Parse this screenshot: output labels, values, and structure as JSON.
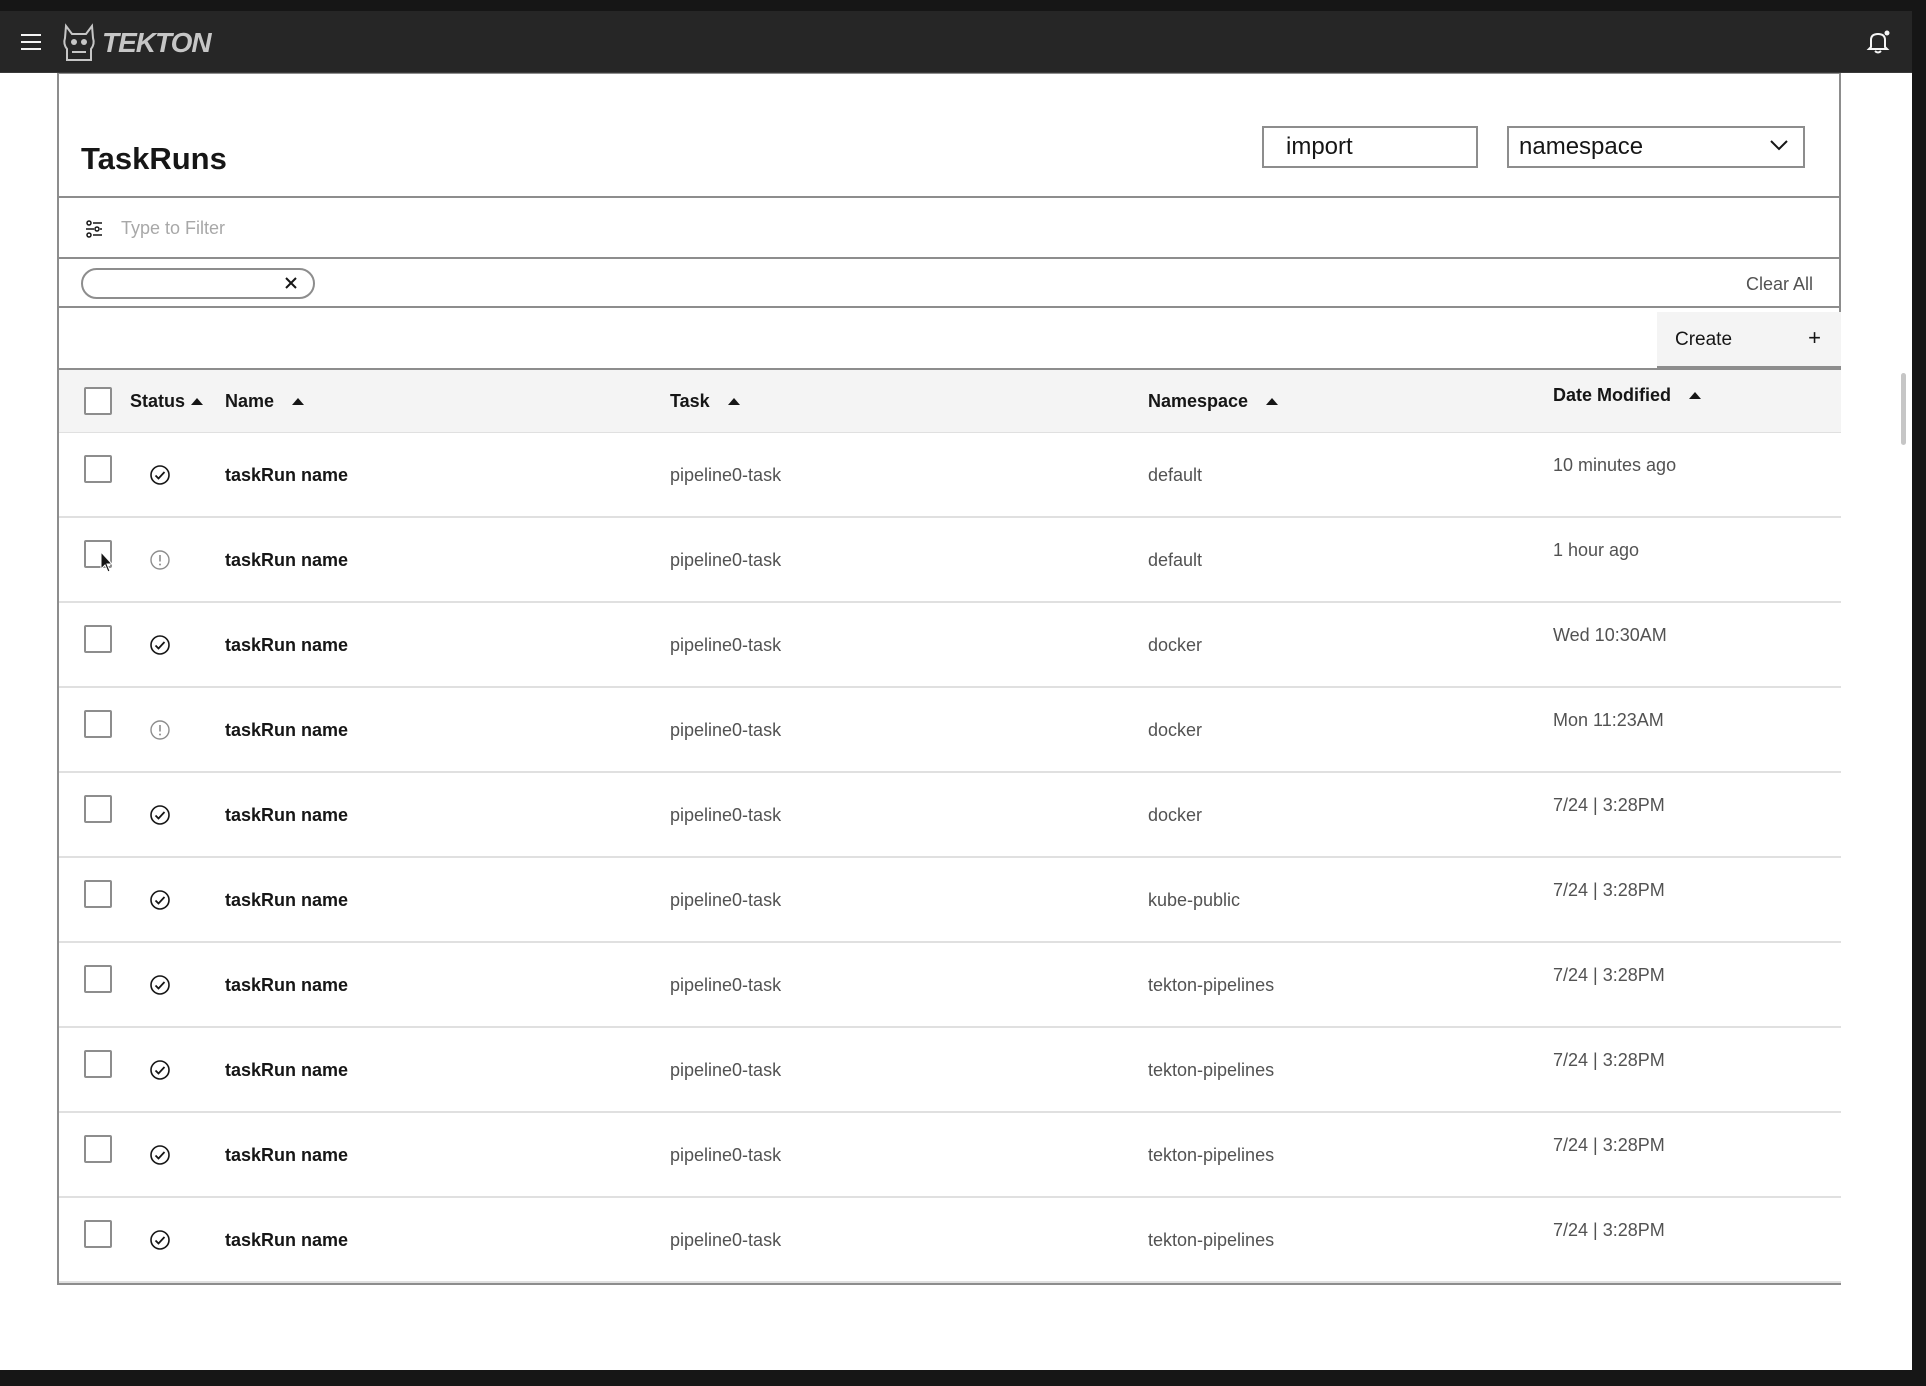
{
  "app": {
    "logo_text": "TEKTON"
  },
  "page": {
    "title": "TaskRuns",
    "import_value": "import",
    "namespace_selected": "namespace",
    "filter_placeholder": "Type to Filter",
    "tag_value": "",
    "clear_all_label": "Clear All",
    "create_label": "Create",
    "create_icon": "+"
  },
  "table": {
    "headers": {
      "status": "Status",
      "name": "Name",
      "task": "Task",
      "namespace": "Namespace",
      "date": "Date Modified"
    },
    "rows": [
      {
        "status": "success",
        "name": "taskRun name",
        "task": "pipeline0-task",
        "namespace": "default",
        "date": "10 minutes ago"
      },
      {
        "status": "warning",
        "name": "taskRun name",
        "task": "pipeline0-task",
        "namespace": "default",
        "date": "1 hour ago"
      },
      {
        "status": "success",
        "name": "taskRun name",
        "task": "pipeline0-task",
        "namespace": "docker",
        "date": "Wed 10:30AM"
      },
      {
        "status": "warning",
        "name": "taskRun name",
        "task": "pipeline0-task",
        "namespace": "docker",
        "date": "Mon 11:23AM"
      },
      {
        "status": "success",
        "name": "taskRun name",
        "task": "pipeline0-task",
        "namespace": "docker",
        "date": "7/24 | 3:28PM"
      },
      {
        "status": "success",
        "name": "taskRun name",
        "task": "pipeline0-task",
        "namespace": "kube-public",
        "date": "7/24 | 3:28PM"
      },
      {
        "status": "success",
        "name": "taskRun name",
        "task": "pipeline0-task",
        "namespace": "tekton-pipelines",
        "date": "7/24 | 3:28PM"
      },
      {
        "status": "success",
        "name": "taskRun name",
        "task": "pipeline0-task",
        "namespace": "tekton-pipelines",
        "date": "7/24 | 3:28PM"
      },
      {
        "status": "success",
        "name": "taskRun name",
        "task": "pipeline0-task",
        "namespace": "tekton-pipelines",
        "date": "7/24 | 3:28PM"
      },
      {
        "status": "success",
        "name": "taskRun name",
        "task": "pipeline0-task",
        "namespace": "tekton-pipelines",
        "date": "7/24 | 3:28PM"
      }
    ]
  },
  "icons": {
    "menu": "hamburger-icon",
    "bell": "notification-bell-icon",
    "filter": "filter-settings-icon",
    "close": "close-icon",
    "chevron": "chevron-down-icon",
    "success": "checkmark-outline-icon",
    "warning": "warning-outline-icon"
  }
}
